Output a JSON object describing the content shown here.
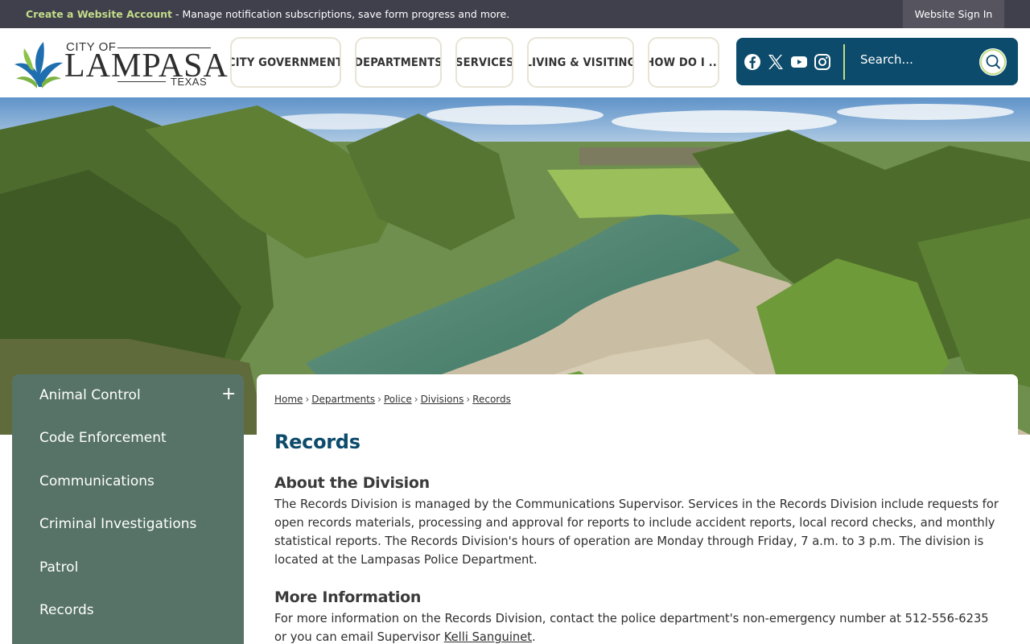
{
  "topbar": {
    "account_link": "Create a Website Account",
    "account_text": " - Manage notification subscriptions, save form progress and more.",
    "sign_in": "Website Sign In"
  },
  "logo": {
    "city_of": "CITY OF",
    "name": "LAMPASAS",
    "state": "TEXAS"
  },
  "nav": {
    "items": [
      {
        "label": "CITY GOVERNMENT"
      },
      {
        "label": "DEPARTMENTS"
      },
      {
        "label": "SERVICES"
      },
      {
        "label": "LIVING & VISITING"
      },
      {
        "label": "HOW DO I ..."
      }
    ]
  },
  "social": {
    "icons": [
      "facebook-icon",
      "x-twitter-icon",
      "youtube-icon",
      "instagram-icon"
    ]
  },
  "search": {
    "placeholder": "Search..."
  },
  "sidebar": {
    "items": [
      {
        "label": "Animal Control",
        "expandable": true,
        "toggle": "+"
      },
      {
        "label": "Code Enforcement"
      },
      {
        "label": "Communications"
      },
      {
        "label": "Criminal Investigations"
      },
      {
        "label": "Patrol"
      },
      {
        "label": "Records"
      }
    ]
  },
  "breadcrumb": {
    "items": [
      "Home",
      "Departments",
      "Police",
      "Divisions",
      "Records"
    ],
    "separator": "›"
  },
  "main": {
    "title": "Records",
    "about_heading": "About the Division",
    "about_text": "The Records Division is managed by the Communications Supervisor. Services in the Records Division  include requests for open records materials, processing and approval for reports to include accident reports, local record checks, and monthly statistical reports. The Records Division's hours of operation are Monday through Friday, 7 a.m. to 3 p.m. The division is located at the Lampasas Police Department.",
    "more_heading": "More Information",
    "more_text_before": "For more information on the Records Division, contact the police department's non-emergency number at 512-556-6235 or you can email Supervisor ",
    "more_link": "Kelli Sanguinet",
    "more_text_after": "."
  },
  "colors": {
    "topbar": "#403f4c",
    "accent_green": "#c2dd88",
    "search_bg": "#0c4b6b",
    "sidebar_bg": "#577367",
    "title": "#0c4b6b"
  }
}
